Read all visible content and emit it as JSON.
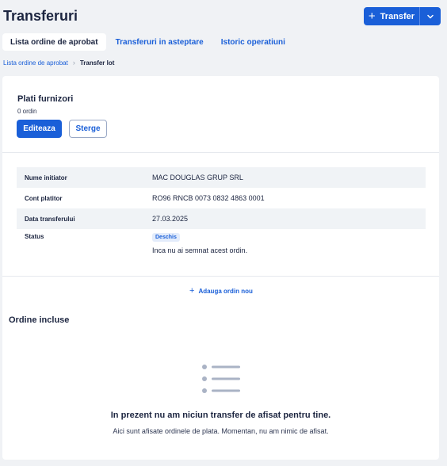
{
  "header": {
    "title": "Transferuri",
    "transfer_button": "Transfer"
  },
  "tabs": [
    {
      "label": "Lista ordine de aprobat",
      "active": true
    },
    {
      "label": "Transferuri in asteptare",
      "active": false
    },
    {
      "label": "Istoric operatiuni",
      "active": false
    }
  ],
  "breadcrumb": {
    "parent": "Lista ordine de aprobat",
    "current": "Transfer lot"
  },
  "group": {
    "title": "Plati furnizori",
    "count": "0 ordin",
    "edit_label": "Editeaza",
    "delete_label": "Sterge"
  },
  "details": [
    {
      "label": "Nume initiator",
      "value": "MAC DOUGLAS GRUP SRL"
    },
    {
      "label": "Cont platitor",
      "value": "RO96 RNCB 0073 0832 4863 0001"
    },
    {
      "label": "Data transferului",
      "value": "27.03.2025"
    }
  ],
  "status": {
    "label": "Status",
    "badge": "Deschis",
    "note": "Inca nu ai semnat acest ordin."
  },
  "add_order_label": "Adauga ordin nou",
  "orders_section": {
    "title": "Ordine incluse",
    "empty_title": "In prezent nu am niciun transfer de afisat pentru tine.",
    "empty_subtitle": "Aici sunt afisate ordinele de plata. Momentan, nu am nimic de afisat."
  },
  "colors": {
    "accent": "#1a5fd8",
    "background": "#f0f2f5",
    "text": "#1c2540"
  }
}
